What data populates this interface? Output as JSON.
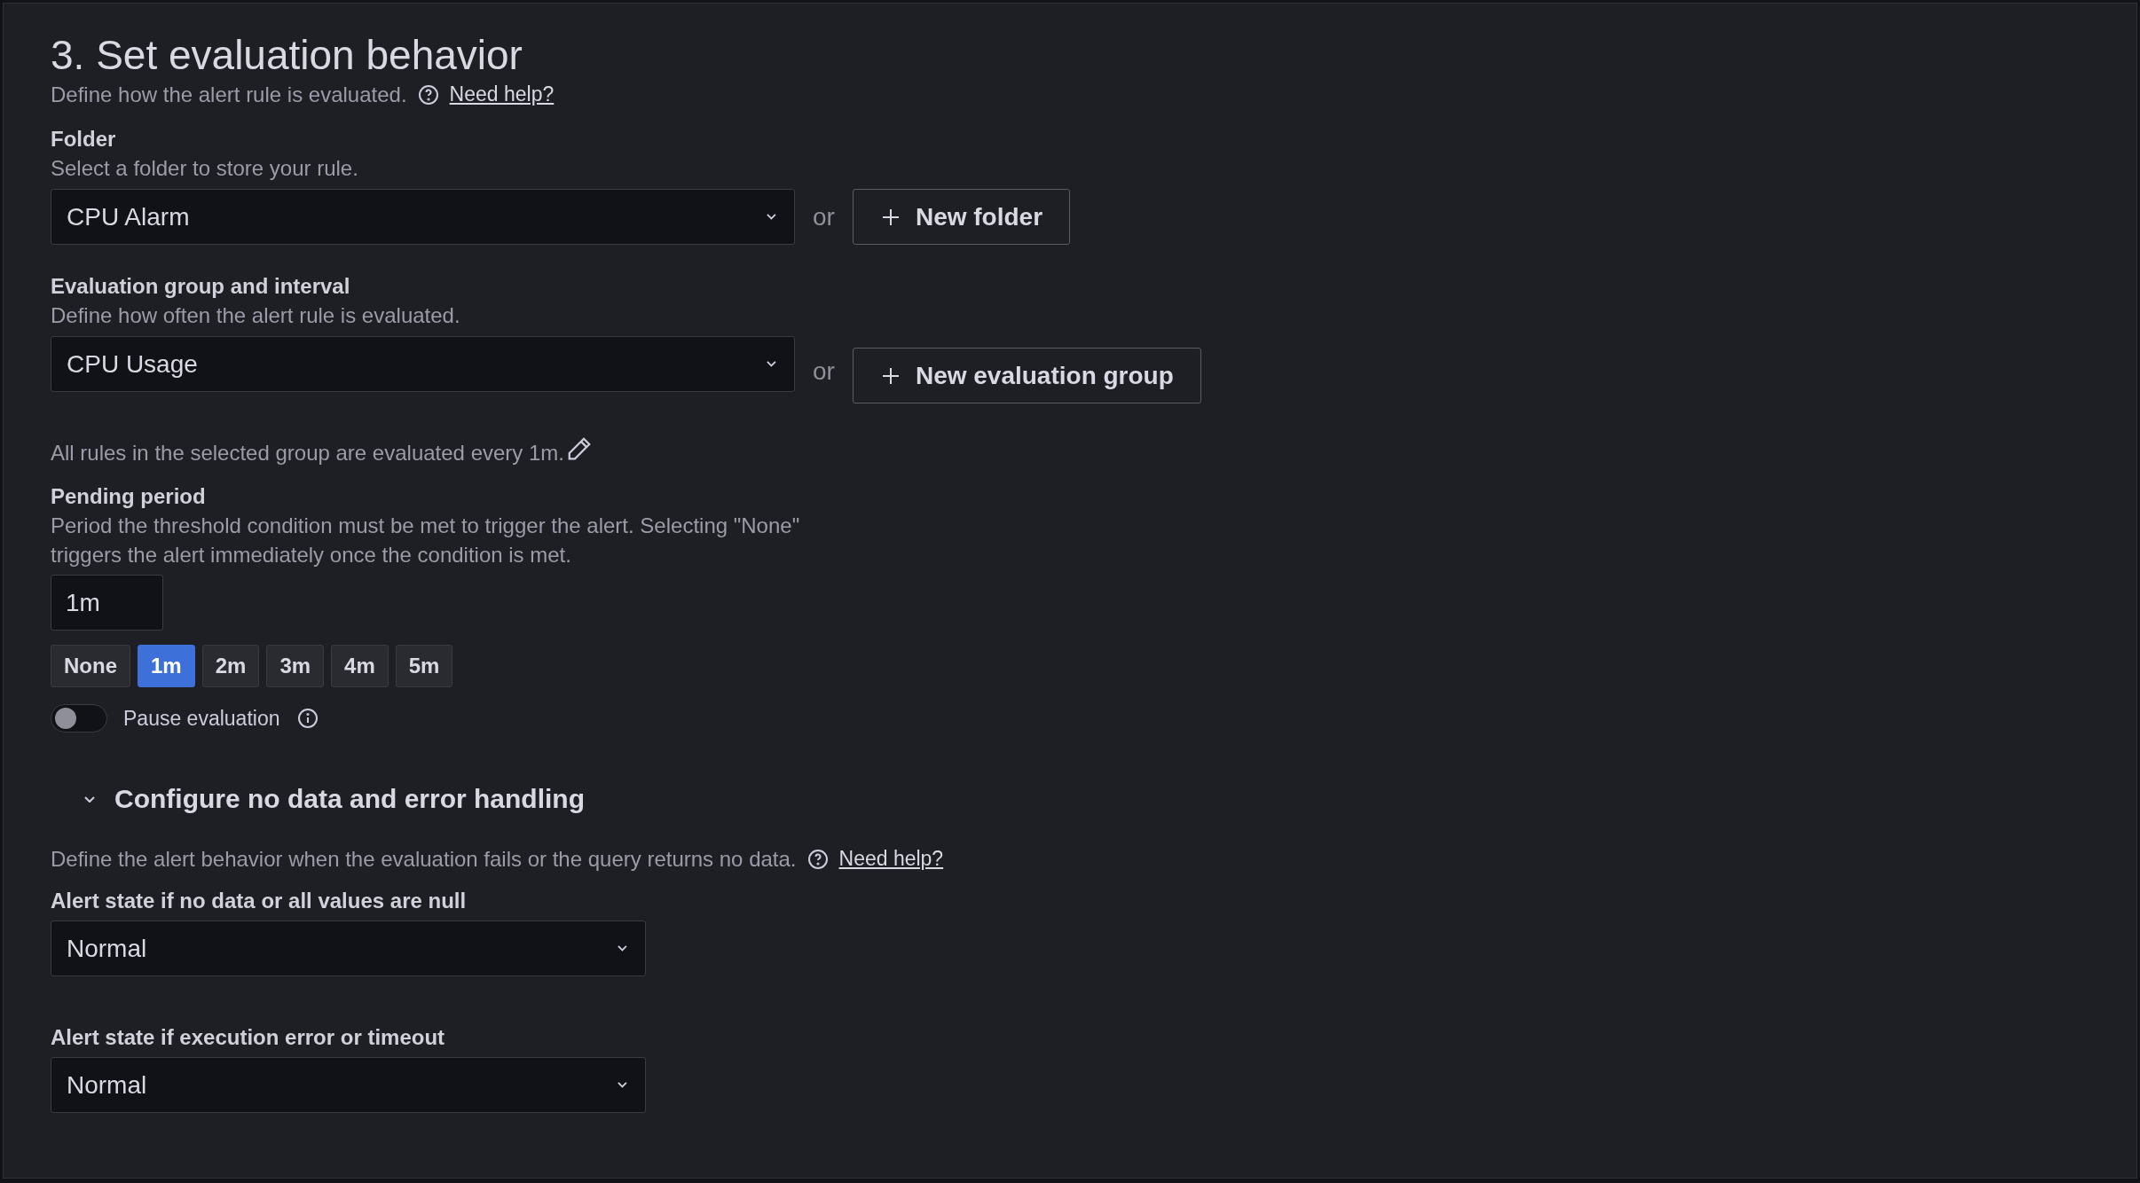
{
  "section": {
    "title": "3. Set evaluation behavior",
    "description": "Define how the alert rule is evaluated.",
    "help_link": "Need help?"
  },
  "folder": {
    "label": "Folder",
    "description": "Select a folder to store your rule.",
    "value": "CPU Alarm",
    "or_text": "or",
    "button": "New folder"
  },
  "evaluation_group": {
    "label": "Evaluation group and interval",
    "description": "Define how often the alert rule is evaluated.",
    "value": "CPU Usage",
    "or_text": "or",
    "button": "New evaluation group"
  },
  "interval_note": "All rules in the selected group are evaluated every 1m.",
  "pending_period": {
    "label": "Pending period",
    "description": "Period the threshold condition must be met to trigger the alert. Selecting \"None\" triggers the alert immediately once the condition is met.",
    "value": "1m",
    "options": [
      {
        "label": "None",
        "selected": false
      },
      {
        "label": "1m",
        "selected": true
      },
      {
        "label": "2m",
        "selected": false
      },
      {
        "label": "3m",
        "selected": false
      },
      {
        "label": "4m",
        "selected": false
      },
      {
        "label": "5m",
        "selected": false
      }
    ]
  },
  "pause_evaluation": {
    "label": "Pause evaluation",
    "on": false
  },
  "no_data_section": {
    "title": "Configure no data and error handling",
    "expanded": true,
    "description": "Define the alert behavior when the evaluation fails or the query returns no data.",
    "help_link": "Need help?",
    "fields": [
      {
        "label": "Alert state if no data or all values are null",
        "value": "Normal"
      },
      {
        "label": "Alert state if execution error or timeout",
        "value": "Normal"
      }
    ]
  }
}
